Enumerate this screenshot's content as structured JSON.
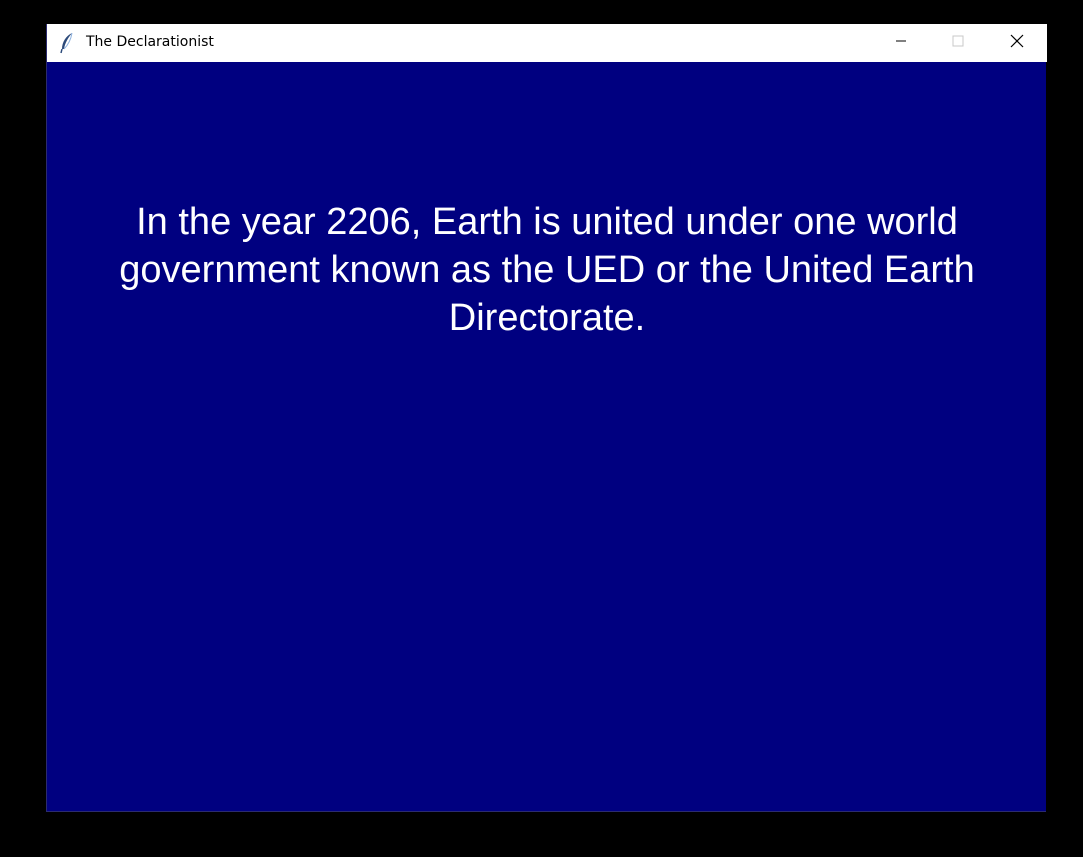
{
  "window": {
    "title": "The Declarationist",
    "app_icon": "feather-icon",
    "controls": {
      "minimize_icon": "minimize-icon",
      "maximize_icon": "maximize-icon",
      "close_icon": "close-icon"
    }
  },
  "content": {
    "background_color": "#000080",
    "text_color": "#ffffff",
    "story_text": "In the year 2206, Earth is united under one world government known as the UED or the United Earth Directorate."
  }
}
